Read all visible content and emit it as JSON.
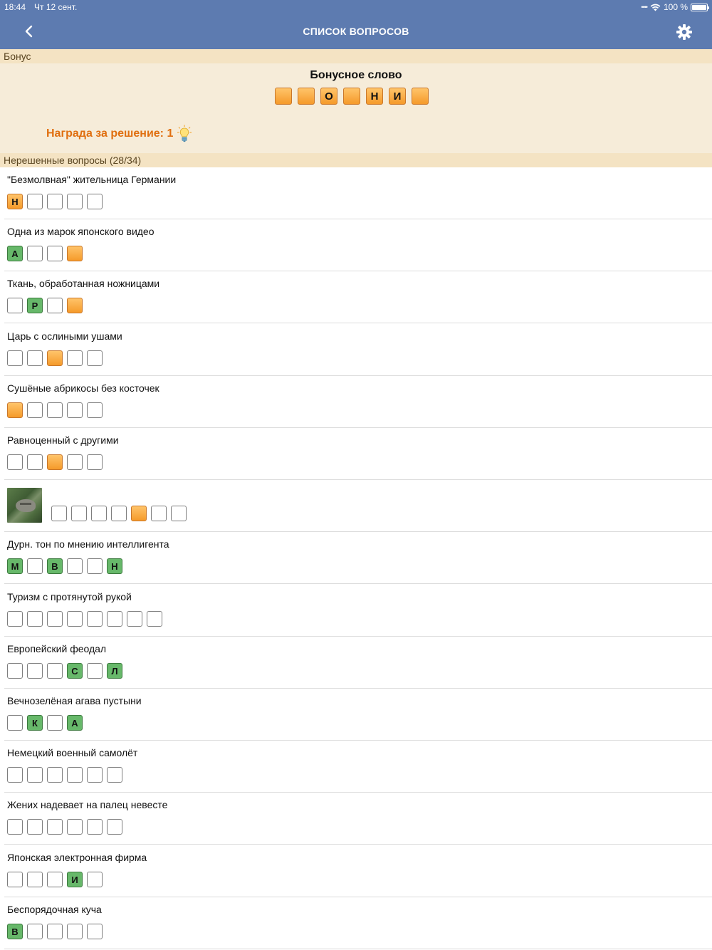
{
  "status": {
    "time": "18:44",
    "date": "Чт 12 сент.",
    "battery": "100 %"
  },
  "nav": {
    "title": "СПИСОК ВОПРОСОВ"
  },
  "bonus": {
    "section": "Бонус",
    "title": "Бонусное слово",
    "letters": [
      "",
      "",
      "О",
      "",
      "Н",
      "И",
      ""
    ],
    "reward": "Награда за решение: 1"
  },
  "unsolved": {
    "section": "Нерешенные вопросы (28/34)"
  },
  "questions": [
    {
      "text": "\"Безмолвная\" жительница Германии",
      "cells": [
        [
          "Н",
          "open"
        ],
        [
          "",
          ""
        ],
        [
          "",
          ""
        ],
        [
          "",
          ""
        ],
        [
          "",
          ""
        ]
      ]
    },
    {
      "text": "Одна из марок японского видео",
      "cells": [
        [
          "А",
          "green"
        ],
        [
          "",
          ""
        ],
        [
          "",
          ""
        ],
        [
          "",
          "open"
        ]
      ]
    },
    {
      "text": "Ткань, обработанная ножницами",
      "cells": [
        [
          "",
          ""
        ],
        [
          "Р",
          "green"
        ],
        [
          "",
          ""
        ],
        [
          "",
          "open"
        ]
      ]
    },
    {
      "text": "Царь с ослиными ушами",
      "cells": [
        [
          "",
          ""
        ],
        [
          "",
          ""
        ],
        [
          "",
          "open"
        ],
        [
          "",
          ""
        ],
        [
          "",
          ""
        ]
      ]
    },
    {
      "text": "Сушёные абрикосы без косточек",
      "cells": [
        [
          "",
          "open"
        ],
        [
          "",
          ""
        ],
        [
          "",
          ""
        ],
        [
          "",
          ""
        ],
        [
          "",
          ""
        ]
      ]
    },
    {
      "text": "Равноценный с другими",
      "cells": [
        [
          "",
          ""
        ],
        [
          "",
          ""
        ],
        [
          "",
          "open"
        ],
        [
          "",
          ""
        ],
        [
          "",
          ""
        ]
      ]
    },
    {
      "text": "",
      "image": true,
      "cells": [
        [
          "",
          ""
        ],
        [
          "",
          ""
        ],
        [
          "",
          ""
        ],
        [
          "",
          ""
        ],
        [
          "",
          "open"
        ],
        [
          "",
          ""
        ],
        [
          "",
          ""
        ]
      ]
    },
    {
      "text": "Дурн. тон по мнению интеллигента",
      "cells": [
        [
          "М",
          "green"
        ],
        [
          "",
          ""
        ],
        [
          "В",
          "green"
        ],
        [
          "",
          ""
        ],
        [
          "",
          ""
        ],
        [
          "Н",
          "green"
        ]
      ]
    },
    {
      "text": "Туризм с протянутой рукой",
      "cells": [
        [
          "",
          ""
        ],
        [
          "",
          ""
        ],
        [
          "",
          ""
        ],
        [
          "",
          ""
        ],
        [
          "",
          ""
        ],
        [
          "",
          ""
        ],
        [
          "",
          ""
        ],
        [
          "",
          ""
        ]
      ]
    },
    {
      "text": "Европейский феодал",
      "cells": [
        [
          "",
          ""
        ],
        [
          "",
          ""
        ],
        [
          "",
          ""
        ],
        [
          "С",
          "green"
        ],
        [
          "",
          ""
        ],
        [
          "Л",
          "green"
        ]
      ]
    },
    {
      "text": "Вечнозелёная агава пустыни",
      "cells": [
        [
          "",
          ""
        ],
        [
          "К",
          "green"
        ],
        [
          "",
          ""
        ],
        [
          "А",
          "green"
        ]
      ]
    },
    {
      "text": "Немецкий военный самолёт",
      "cells": [
        [
          "",
          ""
        ],
        [
          "",
          ""
        ],
        [
          "",
          ""
        ],
        [
          "",
          ""
        ],
        [
          "",
          ""
        ],
        [
          "",
          ""
        ]
      ]
    },
    {
      "text": "Жених надевает на палец невесте",
      "cells": [
        [
          "",
          ""
        ],
        [
          "",
          ""
        ],
        [
          "",
          ""
        ],
        [
          "",
          ""
        ],
        [
          "",
          ""
        ],
        [
          "",
          ""
        ]
      ]
    },
    {
      "text": "Японская электронная фирма",
      "cells": [
        [
          "",
          ""
        ],
        [
          "",
          ""
        ],
        [
          "",
          ""
        ],
        [
          "И",
          "green"
        ],
        [
          "",
          ""
        ]
      ]
    },
    {
      "text": "Беспорядочная куча",
      "cells": [
        [
          "В",
          "green"
        ],
        [
          "",
          ""
        ],
        [
          "",
          ""
        ],
        [
          "",
          ""
        ],
        [
          "",
          ""
        ]
      ]
    }
  ]
}
